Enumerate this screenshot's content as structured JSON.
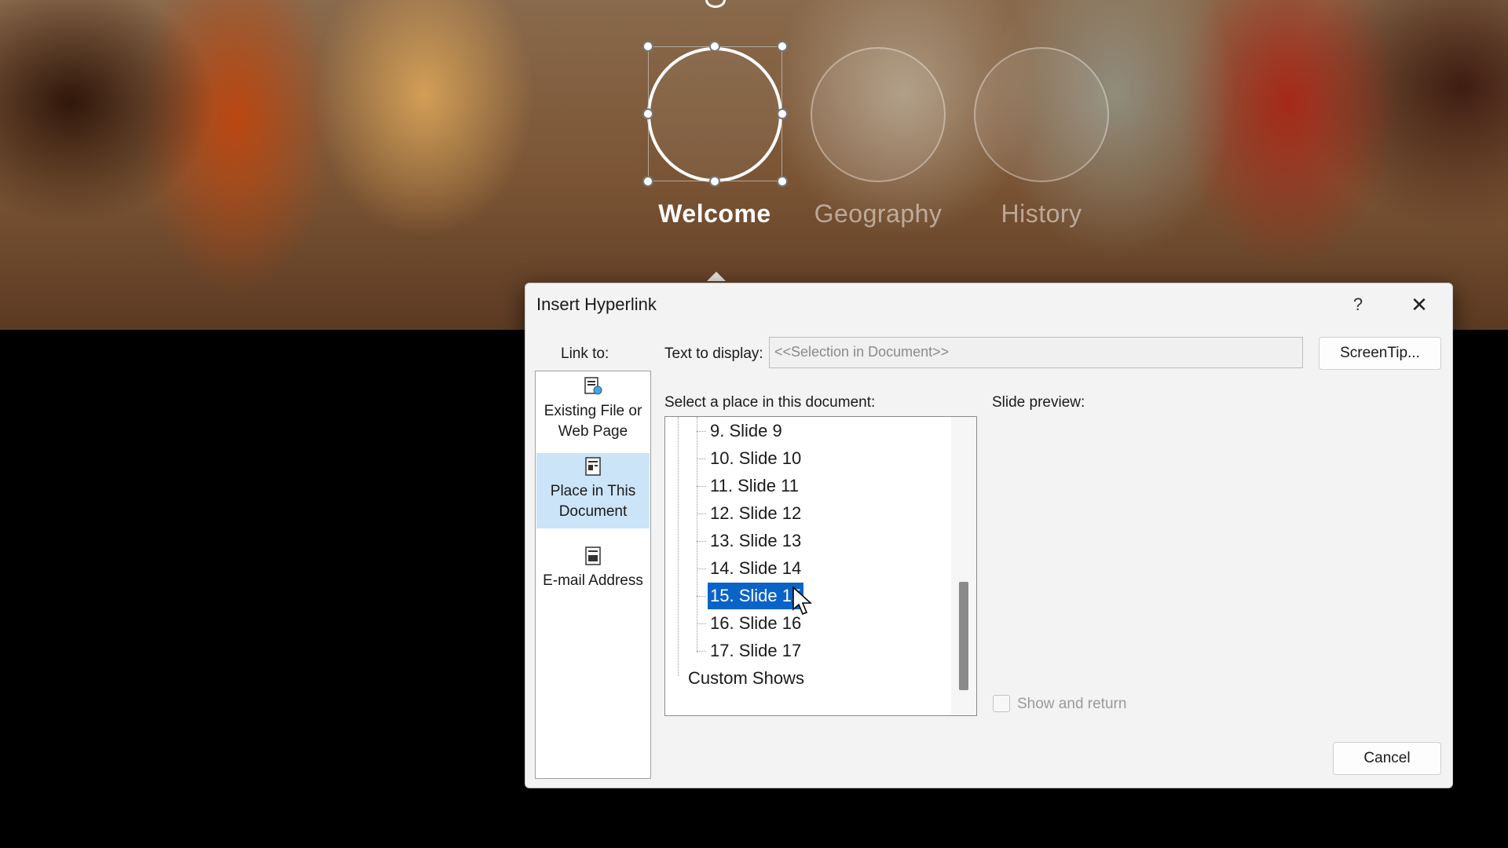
{
  "slide": {
    "nav_items": [
      {
        "label": "Welcome",
        "active": true
      },
      {
        "label": "Geography",
        "active": false
      },
      {
        "label": "History",
        "active": false
      }
    ]
  },
  "dialog": {
    "title": "Insert Hyperlink",
    "help_label": "?",
    "close_label": "✕",
    "link_to_label": "Link to:",
    "link_to_items": [
      {
        "label": "Existing File or Web Page",
        "icon": "web-page-icon",
        "selected": false
      },
      {
        "label": "Place in This Document",
        "icon": "document-place-icon",
        "selected": true
      },
      {
        "label": "E-mail Address",
        "icon": "email-icon",
        "selected": false
      }
    ],
    "text_to_display_label": "Text to display:",
    "text_to_display_value": "<<Selection in Document>>",
    "screentip_label": "ScreenTip...",
    "place_label": "Select a place in this document:",
    "tree_items": [
      {
        "label": "9. Slide 9",
        "selected": false
      },
      {
        "label": "10. Slide 10",
        "selected": false
      },
      {
        "label": "11. Slide 11",
        "selected": false
      },
      {
        "label": "12. Slide 12",
        "selected": false
      },
      {
        "label": "13. Slide 13",
        "selected": false
      },
      {
        "label": "14. Slide 14",
        "selected": false
      },
      {
        "label": "15. Slide 15",
        "selected": true
      },
      {
        "label": "16. Slide 16",
        "selected": false
      },
      {
        "label": "17. Slide 17",
        "selected": false
      }
    ],
    "custom_shows_label": "Custom Shows",
    "slide_preview_label": "Slide preview:",
    "show_and_return_label": "Show and return",
    "show_and_return_checked": false,
    "cancel_label": "Cancel"
  },
  "colors": {
    "selection": "#0a64c8",
    "link_selected_bg": "#cce4f7",
    "dialog_bg": "#f3f3f3"
  }
}
